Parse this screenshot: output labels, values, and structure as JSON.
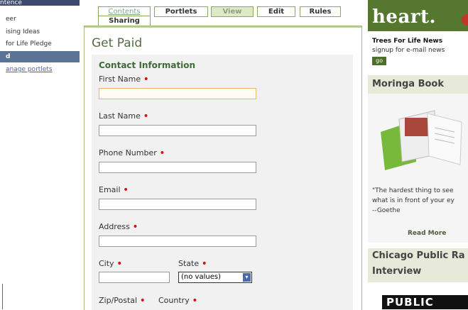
{
  "left_nav": {
    "top_text": "ntence",
    "items": [
      {
        "label": "eer",
        "state": "normal"
      },
      {
        "label": "ising Ideas",
        "state": "normal"
      },
      {
        "label": "for Life Pledge",
        "state": "normal"
      },
      {
        "label": "d",
        "state": "active"
      },
      {
        "label": "anage portlets",
        "state": "link"
      }
    ]
  },
  "tabs": {
    "contents": "Contents",
    "portlets": "Portlets",
    "view": "View",
    "edit": "Edit",
    "rules": "Rules",
    "sharing": "Sharing"
  },
  "page": {
    "title": "Get Paid",
    "section_title": "Contact Information",
    "required_marker": "•",
    "fields": {
      "first_name": "First Name",
      "last_name": "Last Name",
      "phone": "Phone Number",
      "email": "Email",
      "address": "Address",
      "city": "City",
      "state": "State",
      "state_value": "(no values)",
      "zip": "Zip/Postal",
      "country": "Country"
    }
  },
  "right": {
    "hero_text": "heart.",
    "news_title": "Trees For Life News",
    "news_sub": "signup for e-mail news",
    "go_label": "go",
    "book_title": "Moringa Book",
    "quote_line1": "\"The hardest thing to see",
    "quote_line2": "what is in front of your ey",
    "quote_line3": "--Goethe",
    "read_more": "Read More",
    "chicago_line1": "Chicago Public Ra",
    "chicago_line2": "Interview",
    "public_badge": "PUBLIC"
  }
}
